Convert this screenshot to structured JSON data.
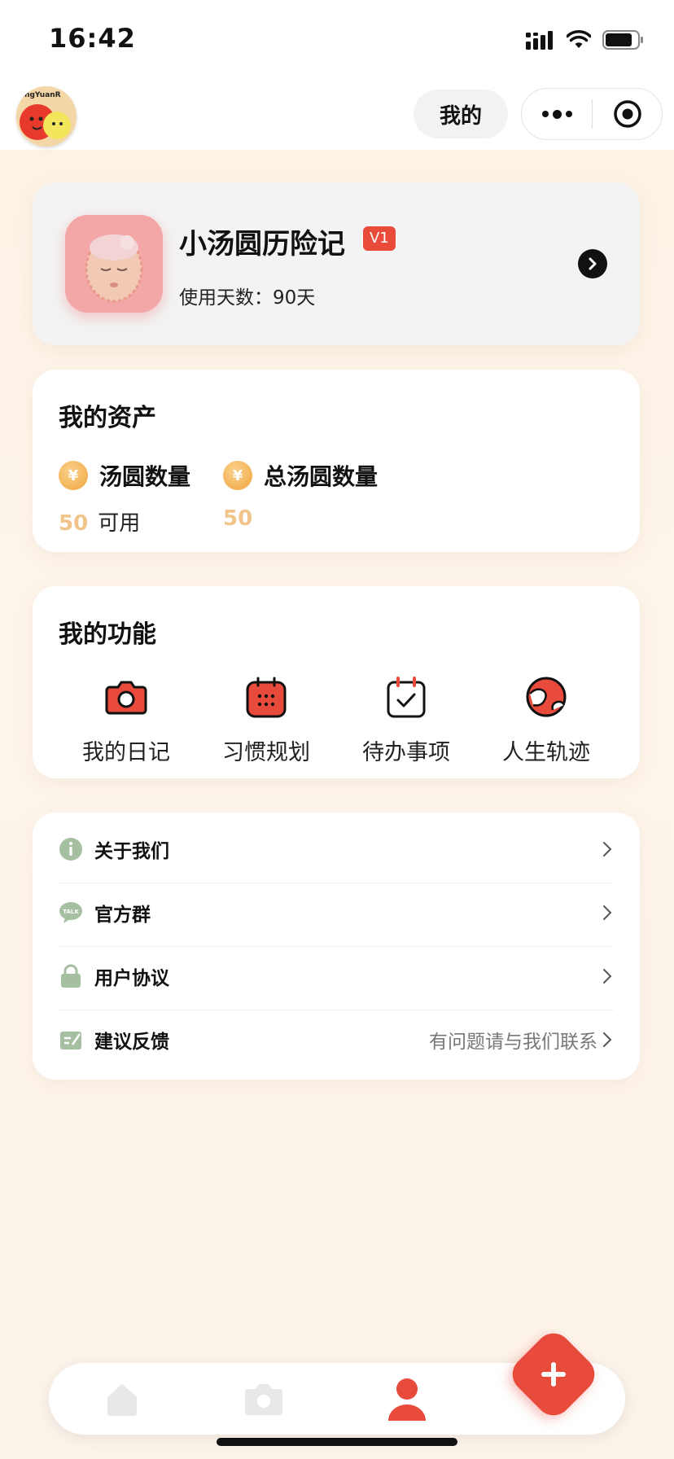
{
  "status_bar": {
    "time": "16:42"
  },
  "nav": {
    "title": "我的",
    "logo_text": "angYuanR",
    "icons": {
      "more": "more-dots-icon",
      "close": "target-circle-icon"
    }
  },
  "profile": {
    "name": "小汤圆历险记",
    "level": "V1",
    "days_label": "使用天数：",
    "days_value": "90天"
  },
  "assets": {
    "title": "我的资产",
    "items": [
      {
        "label": "汤圆数量",
        "value": "50",
        "unit": "可用",
        "icon": "coin-icon"
      },
      {
        "label": "总汤圆数量",
        "value": "50",
        "unit": "",
        "icon": "coin-icon"
      }
    ],
    "coin_symbol": "¥",
    "accent": "#f1c48b"
  },
  "functions": {
    "title": "我的功能",
    "items": [
      {
        "label": "我的日记",
        "icon": "camera-icon"
      },
      {
        "label": "习惯规划",
        "icon": "calendar-icon"
      },
      {
        "label": "待办事项",
        "icon": "checklist-icon"
      },
      {
        "label": "人生轨迹",
        "icon": "globe-icon"
      }
    ],
    "accent": "#e84a3c"
  },
  "menu": {
    "items": [
      {
        "label": "关于我们",
        "hint": "",
        "icon": "info-icon"
      },
      {
        "label": "官方群",
        "hint": "",
        "icon": "talk-bubble-icon"
      },
      {
        "label": "用户协议",
        "hint": "",
        "icon": "lock-icon"
      },
      {
        "label": "建议反馈",
        "hint": "有问题请与我们联系",
        "icon": "feedback-icon"
      }
    ],
    "icon_color": "#a6bfa0"
  },
  "tabbar": {
    "tabs": [
      {
        "name": "home",
        "icon": "home-icon",
        "active": false
      },
      {
        "name": "camera",
        "icon": "camera-icon",
        "active": false
      },
      {
        "name": "profile",
        "icon": "person-icon",
        "active": true
      }
    ],
    "fab_icon": "plus-icon",
    "active_color": "#e84a3c",
    "inactive_color": "#e8e8e8"
  }
}
